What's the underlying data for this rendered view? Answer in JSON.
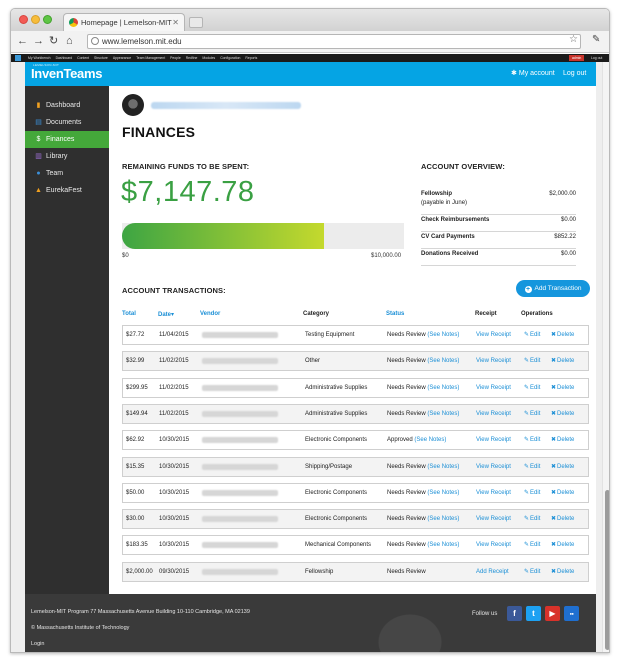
{
  "browser": {
    "tab_title": "Homepage | Lemelson-MIT",
    "url": "www.lemelson.mit.edu"
  },
  "adminbar": {
    "items": [
      "My Workbench",
      "Dashboard",
      "Content",
      "Structure",
      "Appearance",
      "Team Management",
      "People",
      "Redfine",
      "Modules",
      "Configuration",
      "Reports"
    ],
    "user": "admin",
    "logout": "Log out"
  },
  "header": {
    "logo_sub": "LEMELSON-MIT",
    "logo": "InvenTeams",
    "my_account": "My account",
    "log_out": "Log out",
    "brand_color": "#05a4e4"
  },
  "sidebar": {
    "items": [
      {
        "label": "Dashboard",
        "icon": "bar-chart-icon",
        "glyph": "▮",
        "color": "#f0a020"
      },
      {
        "label": "Documents",
        "icon": "document-icon",
        "glyph": "▤",
        "color": "#3b8fd8"
      },
      {
        "label": "Finances",
        "icon": "dollar-icon",
        "glyph": "$",
        "color": "#ffffff"
      },
      {
        "label": "Library",
        "icon": "library-icon",
        "glyph": "▥",
        "color": "#a070d8"
      },
      {
        "label": "Team",
        "icon": "team-icon",
        "glyph": "●",
        "color": "#3b8fd8"
      },
      {
        "label": "EurekaFest",
        "icon": "flask-icon",
        "glyph": "▲",
        "color": "#f0a020"
      }
    ],
    "active_color": "#44a83a"
  },
  "page": {
    "title": "FINANCES"
  },
  "funds": {
    "label": "REMAINING FUNDS TO BE SPENT:",
    "amount": "$7,147.78",
    "progress_fraction": 0.715,
    "min_label": "$0",
    "max_label": "$10,000.00",
    "amount_color": "#3aa043"
  },
  "overview": {
    "title": "ACCOUNT OVERVIEW:",
    "rows": [
      {
        "label": "Fellowship",
        "sublabel": "(payable in June)",
        "value": "$2,000.00"
      },
      {
        "label": "Check Reimbursements",
        "value": "$0.00"
      },
      {
        "label": "CV Card Payments",
        "value": "$852.22"
      },
      {
        "label": "Donations Received",
        "value": "$0.00"
      }
    ]
  },
  "transactions": {
    "title": "ACCOUNT TRANSACTIONS:",
    "add_button": "Add Transaction",
    "columns": {
      "total": "Total",
      "date": "Date",
      "date_sort": "▾",
      "vendor": "Vendor",
      "category": "Category",
      "status": "Status",
      "receipt": "Receipt",
      "operations": "Operations"
    },
    "edit_label": "Edit",
    "delete_label": "Delete",
    "see_notes": "(See Notes)",
    "rows": [
      {
        "total": "$27.72",
        "date": "11/04/2015",
        "category": "Testing Equipment",
        "status": "Needs Review",
        "receipt": "View Receipt",
        "notes": true
      },
      {
        "total": "$32.99",
        "date": "11/02/2015",
        "category": "Other",
        "status": "Needs Review",
        "receipt": "View Receipt",
        "notes": true
      },
      {
        "total": "$299.95",
        "date": "11/02/2015",
        "category": "Administrative Supplies",
        "status": "Needs Review",
        "receipt": "View Receipt",
        "notes": true
      },
      {
        "total": "$149.94",
        "date": "11/02/2015",
        "category": "Administrative Supplies",
        "status": "Needs Review",
        "receipt": "View Receipt",
        "notes": true
      },
      {
        "total": "$62.92",
        "date": "10/30/2015",
        "category": "Electronic Components",
        "status": "Approved",
        "receipt": "View Receipt",
        "notes": true
      },
      {
        "total": "$15.35",
        "date": "10/30/2015",
        "category": "Shipping/Postage",
        "status": "Needs Review",
        "receipt": "View Receipt",
        "notes": true
      },
      {
        "total": "$50.00",
        "date": "10/30/2015",
        "category": "Electronic Components",
        "status": "Needs Review",
        "receipt": "View Receipt",
        "notes": true
      },
      {
        "total": "$30.00",
        "date": "10/30/2015",
        "category": "Electronic Components",
        "status": "Needs Review",
        "receipt": "View Receipt",
        "notes": true
      },
      {
        "total": "$183.35",
        "date": "10/30/2015",
        "category": "Mechanical Components",
        "status": "Needs Review",
        "receipt": "View Receipt",
        "notes": true
      },
      {
        "total": "$2,000.00",
        "date": "09/30/2015",
        "category": "Fellowship",
        "status": "Needs Review",
        "receipt": "Add Receipt",
        "notes": false
      }
    ]
  },
  "footer": {
    "address": "Lemelson-MIT Program 77 Massachusetts Avenue Building 10-110 Cambridge, MA 02139",
    "copyright": "© Massachusetts Institute of Technology",
    "login": "Login",
    "follow_us": "Follow us",
    "social": [
      {
        "name": "facebook-icon",
        "glyph": "f",
        "color": "#3b5998"
      },
      {
        "name": "twitter-icon",
        "glyph": "t",
        "color": "#1da1f2"
      },
      {
        "name": "youtube-icon",
        "glyph": "▶",
        "color": "#d8322a"
      },
      {
        "name": "flickr-icon",
        "glyph": "●●",
        "color": "#1f6fd0"
      }
    ]
  }
}
